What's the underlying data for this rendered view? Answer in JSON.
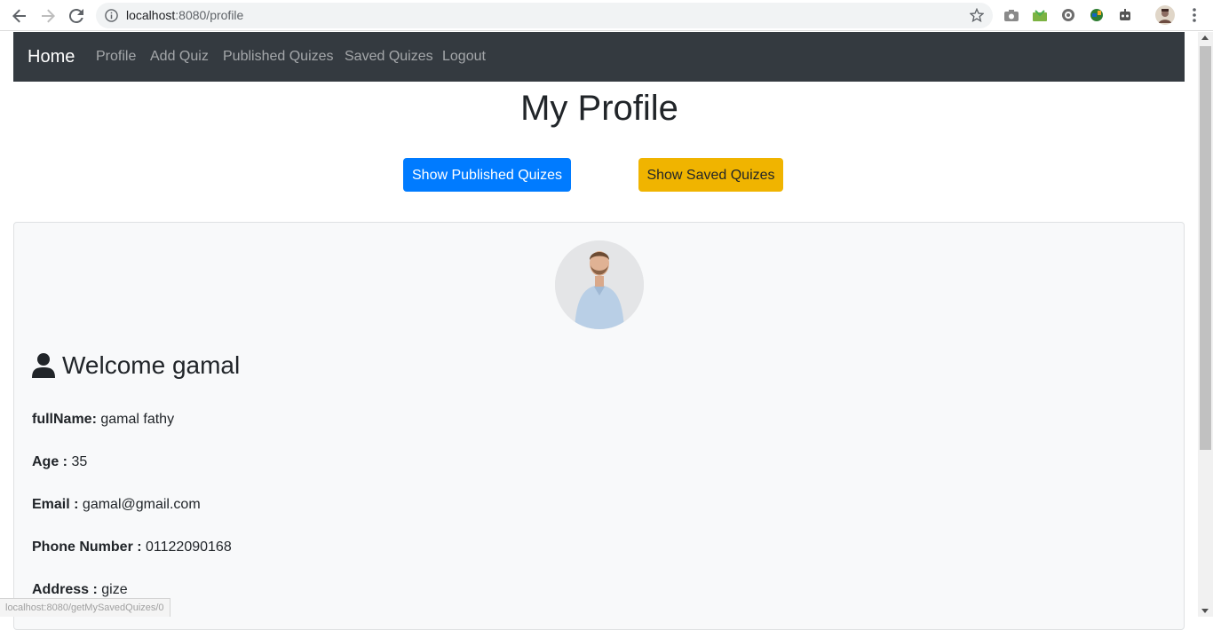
{
  "browser": {
    "url_host": "localhost",
    "url_rest": ":8080/profile"
  },
  "navbar": {
    "brand": "Home",
    "links": [
      "Profile",
      "Add Quiz",
      "Published Quizes",
      "Saved Quizes",
      "Logout"
    ]
  },
  "page": {
    "title": "My Profile",
    "published_button": "Show Published Quizes",
    "saved_button": "Show Saved Quizes"
  },
  "profile": {
    "welcome": "Welcome gamal",
    "fields": [
      {
        "label": "fullName:",
        "value": "gamal fathy"
      },
      {
        "label": "Age :",
        "value": "35"
      },
      {
        "label": "Email :",
        "value": "gamal@gmail.com"
      },
      {
        "label": "Phone Number :",
        "value": "01122090168"
      },
      {
        "label": "Address :",
        "value": "gize"
      }
    ]
  },
  "status_bar": {
    "text": "localhost:8080/getMySavedQuizes/0"
  },
  "colors": {
    "navbar_bg": "#343a40",
    "primary": "#007bff",
    "warning": "#f0b400",
    "card_bg": "#f8f9fa"
  }
}
